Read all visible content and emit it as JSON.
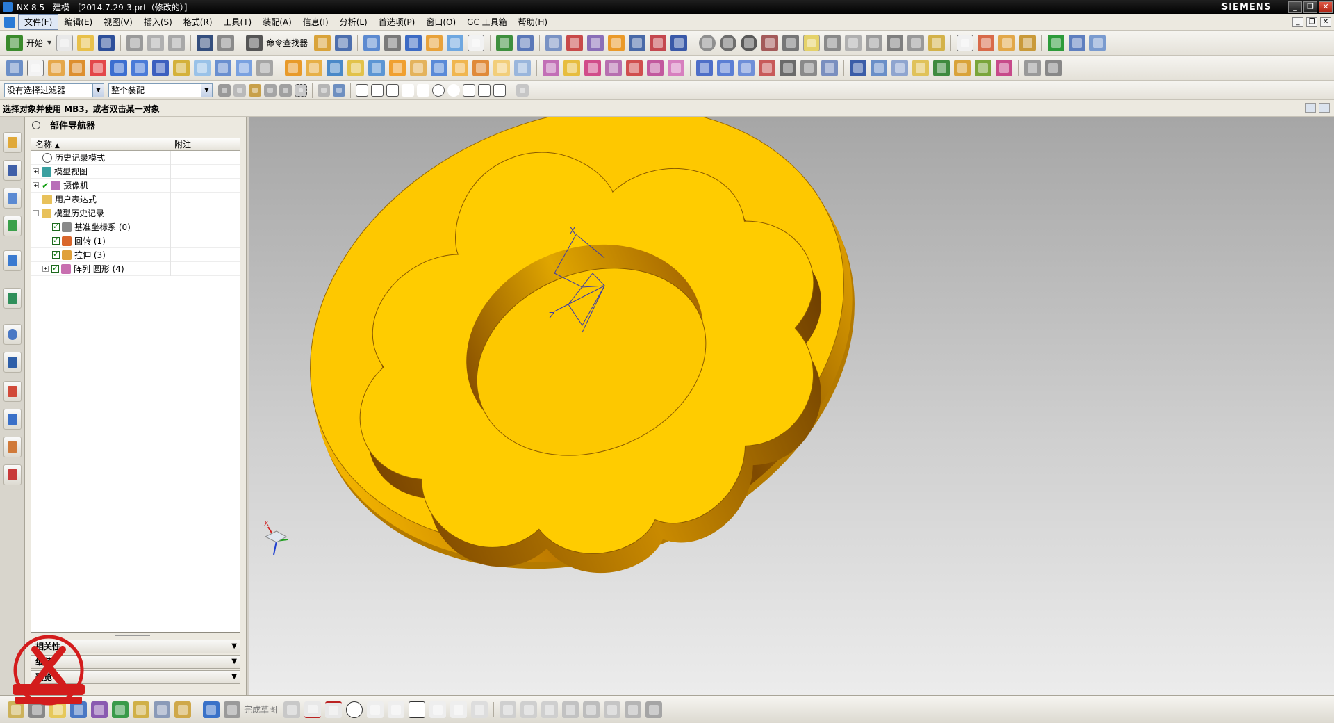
{
  "window": {
    "title": "NX 8.5 - 建模 - [2014.7.29-3.prt（修改的）]",
    "brand": "SIEMENS"
  },
  "menu": {
    "items": [
      "文件(F)",
      "编辑(E)",
      "视图(V)",
      "插入(S)",
      "格式(R)",
      "工具(T)",
      "装配(A)",
      "信息(I)",
      "分析(L)",
      "首选项(P)",
      "窗口(O)",
      "GC 工具箱",
      "帮助(H)"
    ]
  },
  "toolbar": {
    "start_label": "开始",
    "command_finder_label": "命令查找器"
  },
  "selection_bar": {
    "filter_value": "没有选择过滤器",
    "scope_value": "整个装配"
  },
  "cue_line": "选择对象并使用 MB3，或者双击某一对象",
  "navigator": {
    "title": "部件导航器",
    "col_name": "名称",
    "col_note": "附注",
    "rows": [
      {
        "label": "历史记录模式",
        "indent": 0
      },
      {
        "label": "模型视图",
        "indent": 0
      },
      {
        "label": "摄像机",
        "indent": 0
      },
      {
        "label": "用户表达式",
        "indent": 0
      },
      {
        "label": "模型历史记录",
        "indent": 0
      },
      {
        "label": "基准坐标系 (0)",
        "indent": 1
      },
      {
        "label": "回转 (1)",
        "indent": 1
      },
      {
        "label": "拉伸 (3)",
        "indent": 1
      },
      {
        "label": "阵列 圆形 (4)",
        "indent": 1
      }
    ],
    "sections": [
      "相关性",
      "细节",
      "预览"
    ]
  },
  "statusbar": {
    "finish_sketch_label": "完成草图"
  },
  "watermark": {
    "text": "UG爱好者",
    "url": "WWW.UGSNX.COM"
  },
  "model": {
    "color": "#f5c200",
    "shadow": "#a06a00",
    "csys_labels": [
      "X",
      "Y",
      "Z"
    ]
  }
}
